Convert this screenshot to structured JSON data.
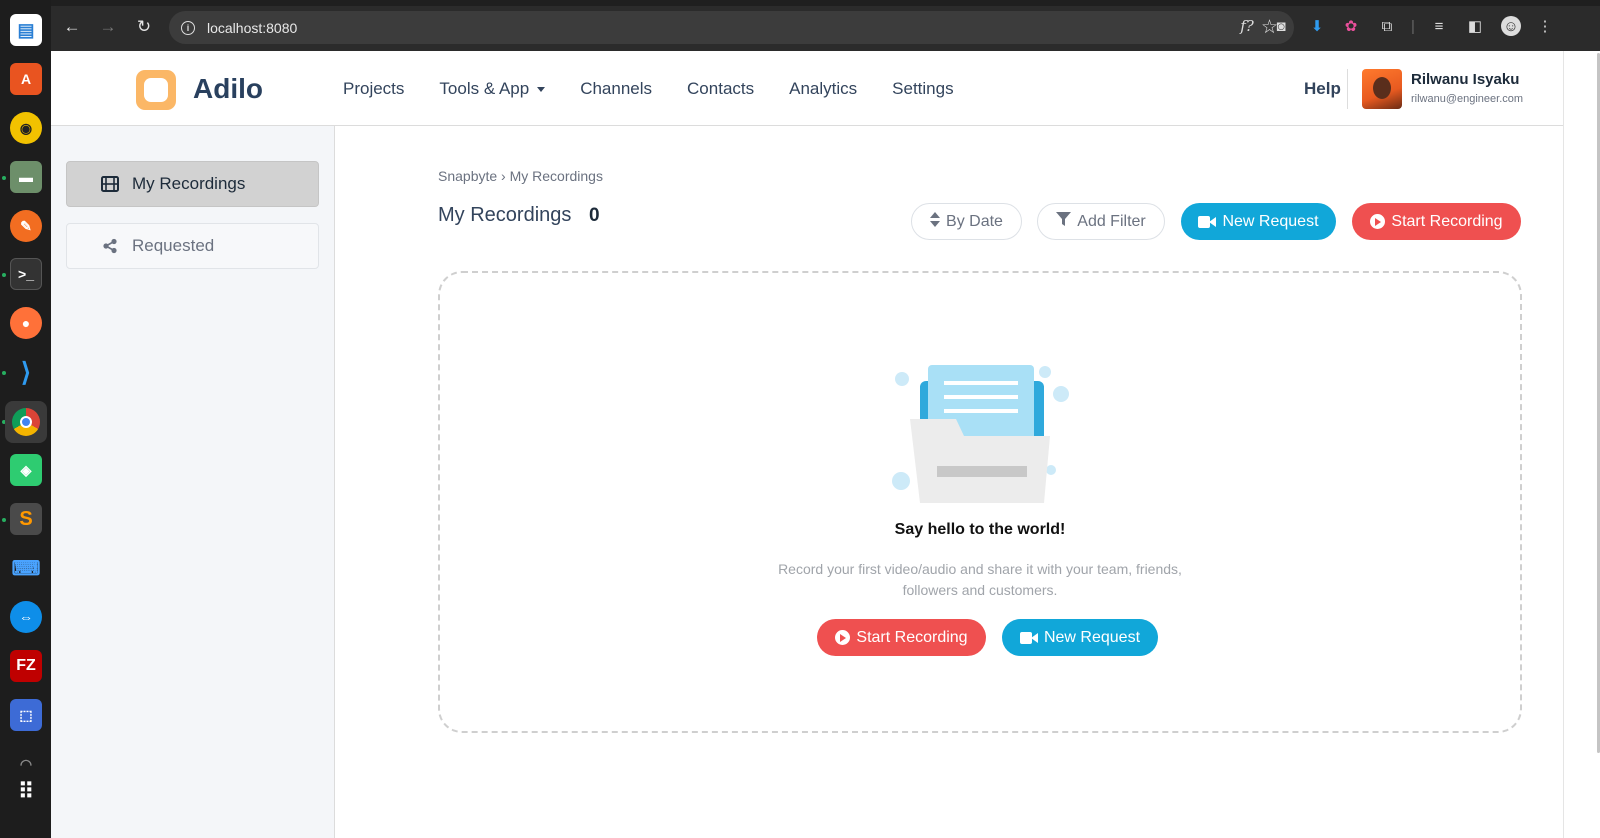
{
  "browser": {
    "url": "localhost:8080"
  },
  "header": {
    "brand": "Adilo",
    "menu": [
      "Projects",
      "Tools & App",
      "Channels",
      "Contacts",
      "Analytics",
      "Settings"
    ],
    "help": "Help",
    "user": {
      "name": "Rilwanu Isyaku",
      "email": "rilwanu@engineer.com"
    }
  },
  "sidebar": {
    "items": [
      {
        "label": "My Recordings",
        "icon": "film-icon",
        "active": true
      },
      {
        "label": "Requested",
        "icon": "share-icon",
        "active": false
      }
    ]
  },
  "main": {
    "breadcrumb": "Snapbyte › My Recordings",
    "title": "My Recordings",
    "count": "0",
    "toolbar": {
      "sort_label": "By Date",
      "filter_label": "Add Filter",
      "new_request_label": "New Request",
      "start_recording_label": "Start Recording"
    },
    "empty": {
      "title": "Say hello to the world!",
      "description": "Record your first video/audio and share it with your team, friends, followers and customers.",
      "start_recording_label": "Start Recording",
      "new_request_label": "New Request"
    }
  },
  "colors": {
    "brand_orange": "#fbb766",
    "primary_blue": "#11a7d9",
    "danger_red": "#ef5050",
    "text_dark": "#33445c"
  }
}
